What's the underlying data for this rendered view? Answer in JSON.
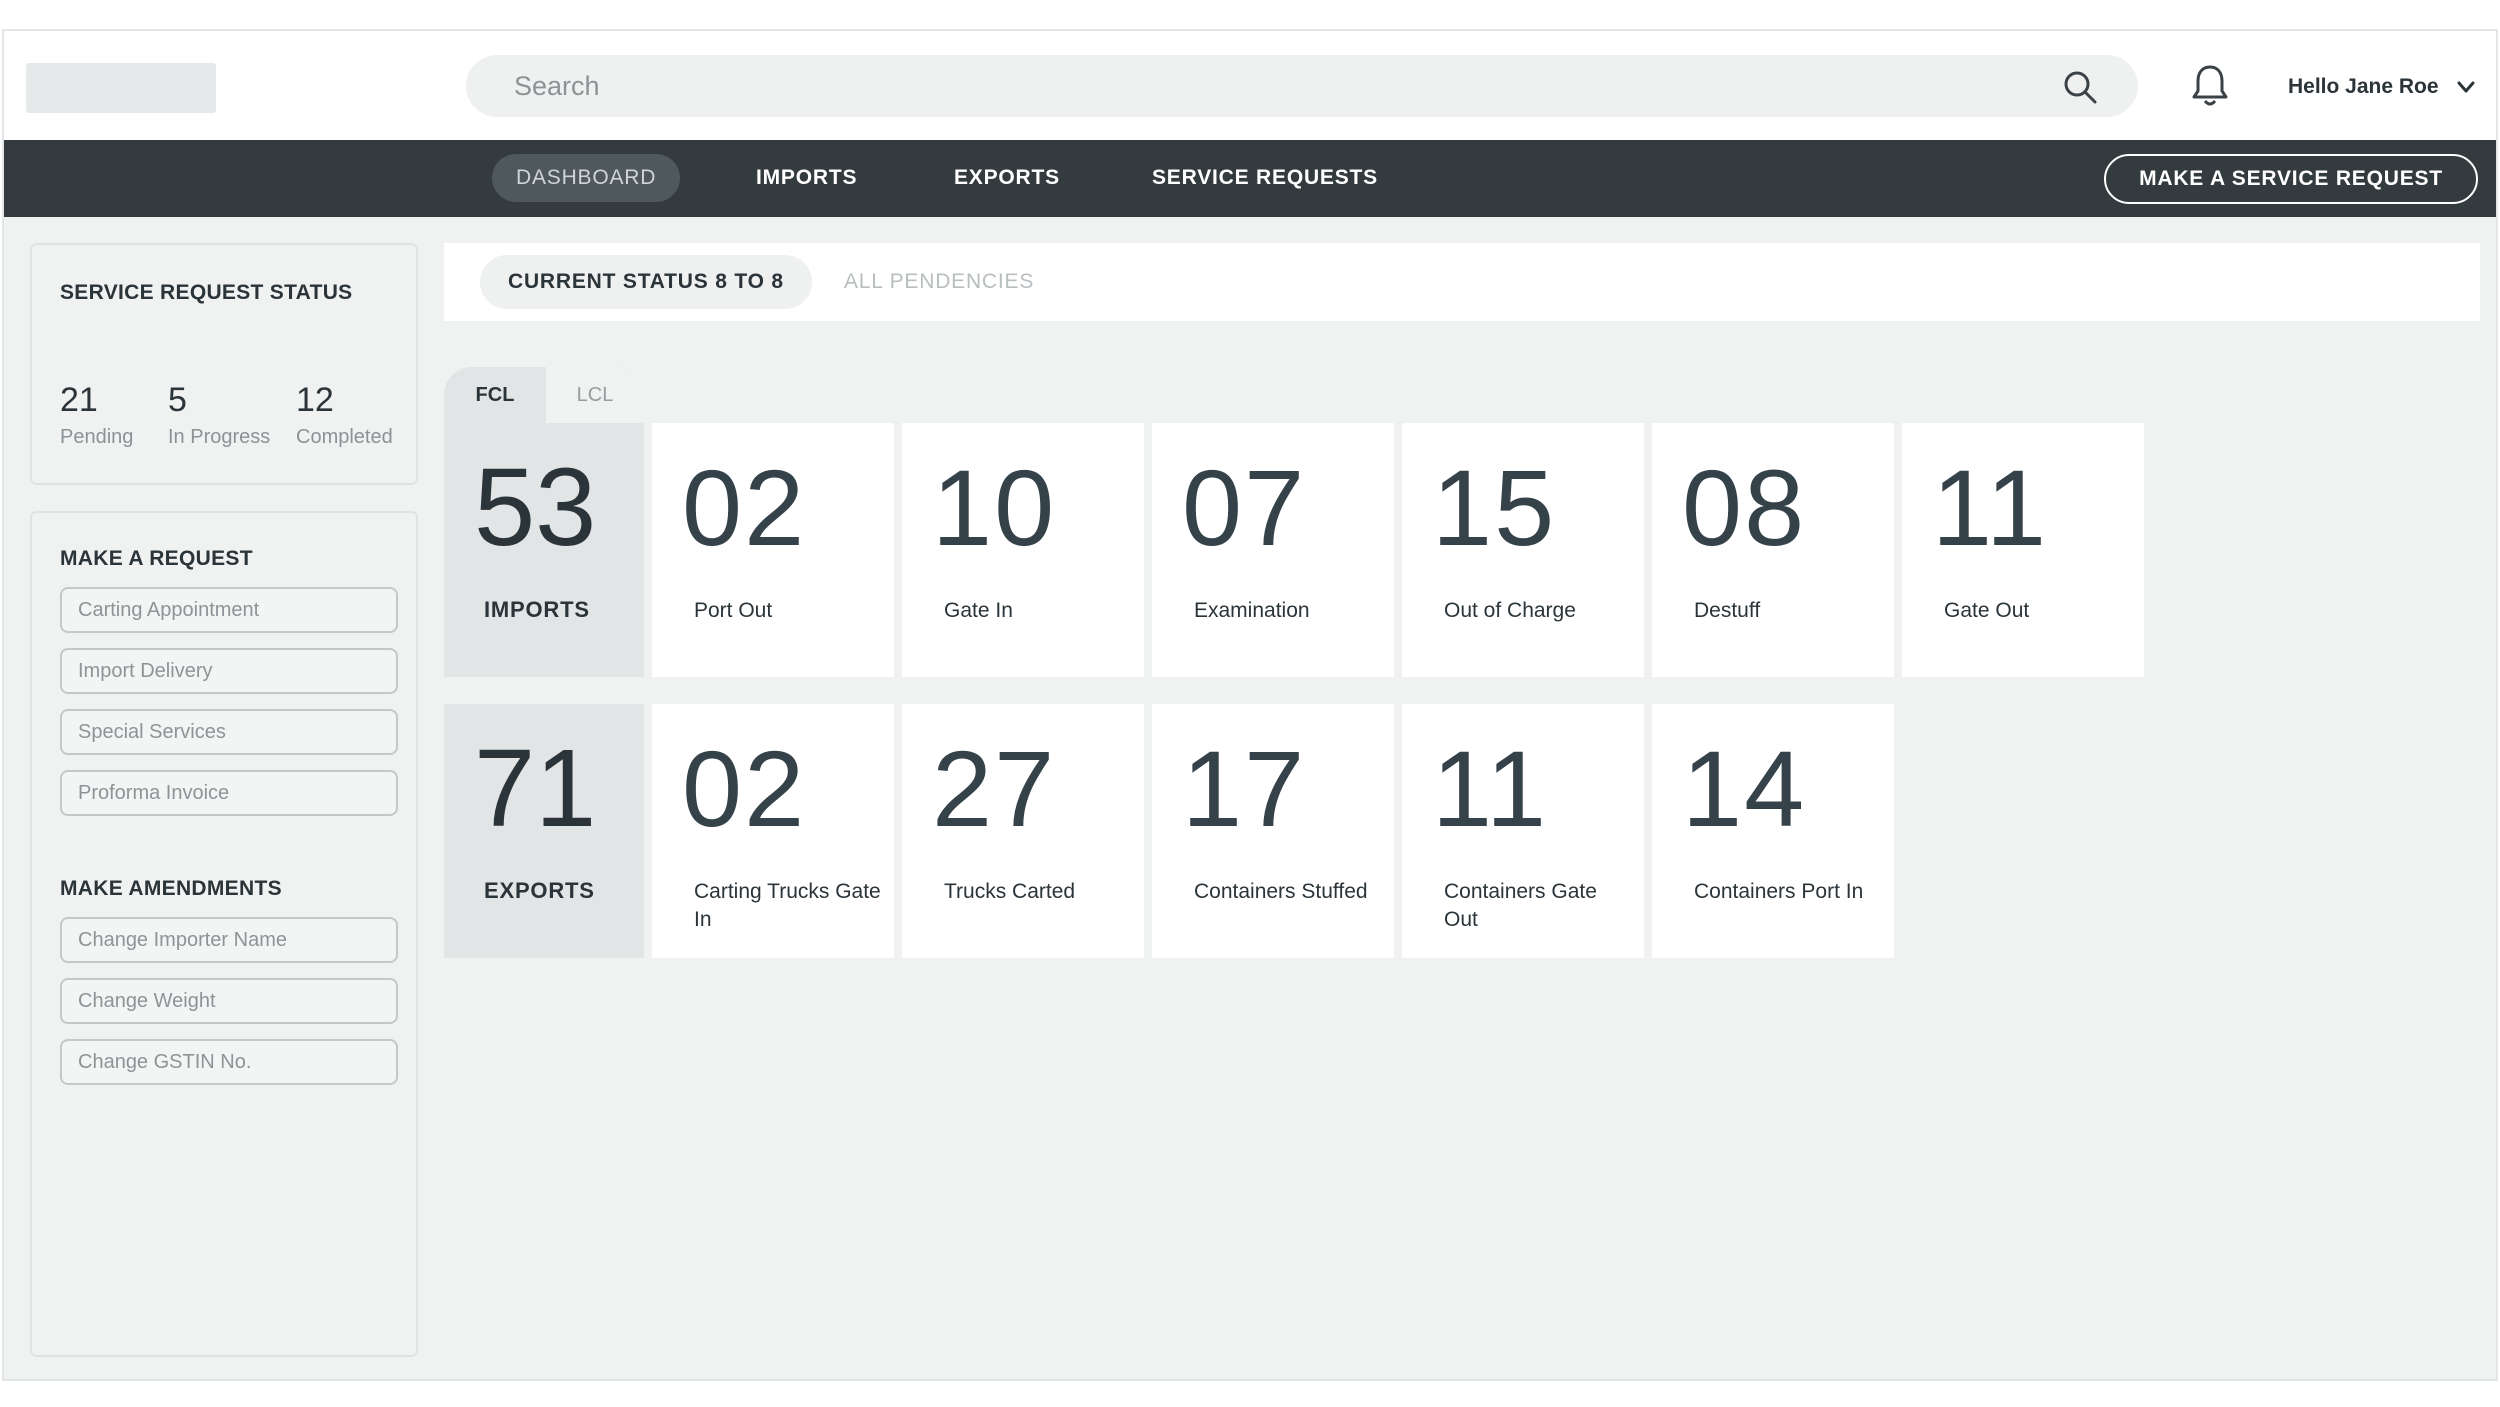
{
  "header": {
    "search_placeholder": "Search",
    "user_greeting": "Hello Jane Roe"
  },
  "nav": {
    "items": [
      {
        "label": "DASHBOARD",
        "active": true
      },
      {
        "label": "IMPORTS",
        "active": false
      },
      {
        "label": "EXPORTS",
        "active": false
      },
      {
        "label": "SERVICE REQUESTS",
        "active": false
      }
    ],
    "cta": "MAKE A SERVICE REQUEST"
  },
  "sidebar": {
    "status": {
      "title": "SERVICE REQUEST STATUS",
      "stats": [
        {
          "value": "21",
          "label": "Pending"
        },
        {
          "value": "5",
          "label": "In Progress"
        },
        {
          "value": "12",
          "label": "Completed"
        }
      ]
    },
    "request": {
      "title": "MAKE A REQUEST",
      "items": [
        "Carting Appointment",
        "Import Delivery",
        "Special Services",
        "Proforma Invoice"
      ]
    },
    "amendments": {
      "title": "MAKE AMENDMENTS",
      "items": [
        "Change Importer Name",
        "Change Weight",
        "Change GSTIN No."
      ]
    }
  },
  "main": {
    "tabs": [
      {
        "label": "CURRENT STATUS 8 TO 8",
        "active": true
      },
      {
        "label": "ALL PENDENCIES",
        "active": false
      }
    ],
    "segments": [
      {
        "label": "FCL",
        "active": true
      },
      {
        "label": "LCL",
        "active": false
      }
    ],
    "imports": {
      "total": "53",
      "label": "IMPORTS",
      "tiles": [
        {
          "value": "02",
          "label": "Port Out"
        },
        {
          "value": "10",
          "label": "Gate In"
        },
        {
          "value": "07",
          "label": "Examination"
        },
        {
          "value": "15",
          "label": "Out of Charge"
        },
        {
          "value": "08",
          "label": "Destuff"
        },
        {
          "value": "11",
          "label": "Gate Out"
        }
      ]
    },
    "exports": {
      "total": "71",
      "label": "EXPORTS",
      "tiles": [
        {
          "value": "02",
          "label": "Carting Trucks Gate In"
        },
        {
          "value": "27",
          "label": "Trucks Carted"
        },
        {
          "value": "17",
          "label": "Containers Stuffed"
        },
        {
          "value": "11",
          "label": "Containers Gate Out"
        },
        {
          "value": "14",
          "label": "Containers Port In"
        }
      ]
    }
  }
}
